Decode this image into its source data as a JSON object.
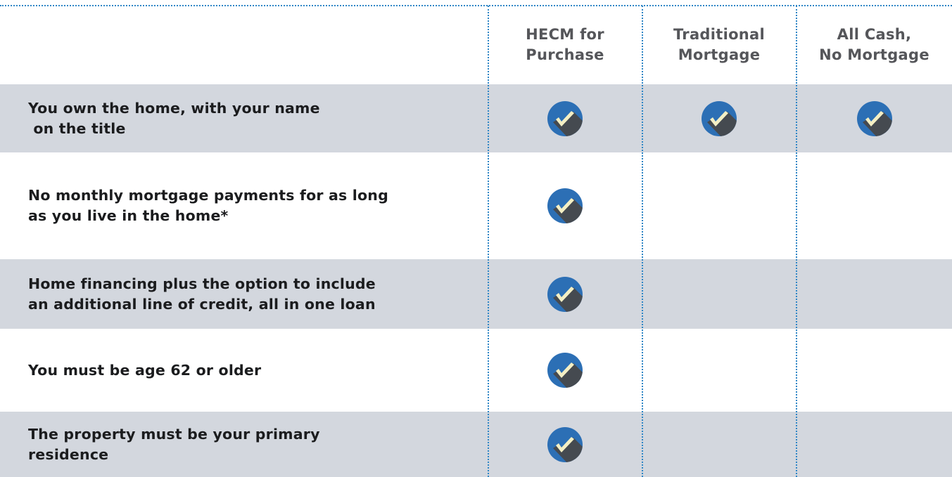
{
  "columns": [
    {
      "label": "HECM for\nPurchase"
    },
    {
      "label": "Traditional\nMortgage"
    },
    {
      "label": "All Cash,\nNo Mortgage"
    }
  ],
  "rows": [
    {
      "label": "You own the home, with your name\n on the title",
      "checks": [
        true,
        true,
        true
      ]
    },
    {
      "label": "No monthly mortgage payments for as long\nas you live in the home*",
      "checks": [
        true,
        false,
        false
      ]
    },
    {
      "label": "Home financing plus the option to include\nan additional line of credit, all in one loan",
      "checks": [
        true,
        false,
        false
      ]
    },
    {
      "label": "You must be age 62 or older",
      "checks": [
        true,
        false,
        false
      ]
    },
    {
      "label": "The property must be your primary\nresidence",
      "checks": [
        true,
        false,
        false
      ]
    }
  ],
  "colors": {
    "accent": "#2f86c6",
    "row_shade": "#d3d7de",
    "check_circle": "#2c6fb5",
    "check_shadow": "#454a50",
    "check_mark": "#f4efc4"
  },
  "icons": {
    "check": "check-icon"
  }
}
